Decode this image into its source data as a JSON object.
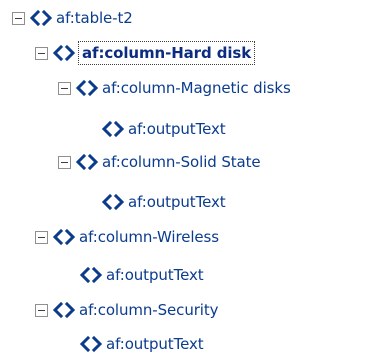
{
  "tree": {
    "nodes": [
      {
        "label": "af:table-t2",
        "expanded": true
      },
      {
        "label": "af:column-Hard disk",
        "expanded": true,
        "selected": true
      },
      {
        "label": "af:column-Magnetic disks",
        "expanded": true
      },
      {
        "label": "af:outputText"
      },
      {
        "label": "af:column-Solid State",
        "expanded": true
      },
      {
        "label": "af:outputText"
      },
      {
        "label": "af:column-Wireless",
        "expanded": true
      },
      {
        "label": "af:outputText"
      },
      {
        "label": "af:column-Security",
        "expanded": true
      },
      {
        "label": "af:outputText"
      }
    ]
  },
  "colors": {
    "text": "#0b3c8e",
    "icon": "#0a3b8c",
    "toggle_border": "#8f8f8f"
  },
  "icons": {
    "toggle": "collapse-toggle-icon",
    "element": "tag-icon"
  }
}
